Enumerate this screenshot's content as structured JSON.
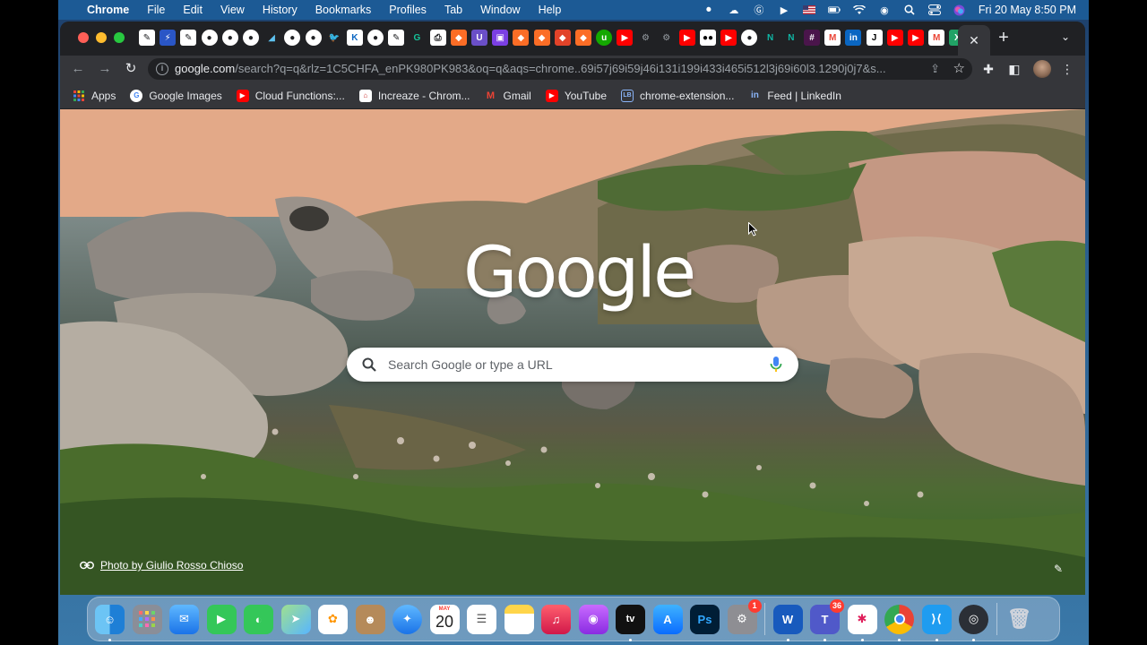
{
  "menubar": {
    "app_name": "Chrome",
    "menus": [
      "File",
      "Edit",
      "View",
      "History",
      "Bookmarks",
      "Profiles",
      "Tab",
      "Window",
      "Help"
    ],
    "clock": "Fri 20 May  8:50 PM"
  },
  "browser": {
    "url_host": "google.com",
    "url_rest": "/search?q=q&rlz=1C5CHFA_enPK980PK983&oq=q&aqs=chrome..69i57j69i59j46i131i199i433i465i512l3j69i60l3.1290j0j7&s...",
    "bookmarks": [
      {
        "label": "Apps",
        "icon": "apps-grid-icon",
        "color": "#ea4335"
      },
      {
        "label": "Google Images",
        "icon": "google-g-icon",
        "color": "#ffffff"
      },
      {
        "label": "Cloud Functions:...",
        "icon": "youtube-icon",
        "color": "#ff0000"
      },
      {
        "label": "Increaze - Chrom...",
        "icon": "increaze-icon",
        "color": "#ffffff"
      },
      {
        "label": "Gmail",
        "icon": "gmail-icon",
        "color": "#ea4335"
      },
      {
        "label": "YouTube",
        "icon": "youtube-icon",
        "color": "#ff0000"
      },
      {
        "label": "chrome-extension...",
        "icon": "lb-icon",
        "color": "#1a73e8"
      },
      {
        "label": "Feed | LinkedIn",
        "icon": "linkedin-icon",
        "color": "#0a66c2"
      }
    ]
  },
  "ntp": {
    "logo": "Google",
    "search_placeholder": "Search Google or type a URL",
    "attribution": "Photo by Giulio Rosso Chioso"
  },
  "dock": {
    "calendar_month": "MAY",
    "calendar_day": "20",
    "system_prefs_badge": "1",
    "teams_badge": "36",
    "word_label": "W",
    "photoshop_label": "Ps",
    "appletv_label": "tv"
  }
}
